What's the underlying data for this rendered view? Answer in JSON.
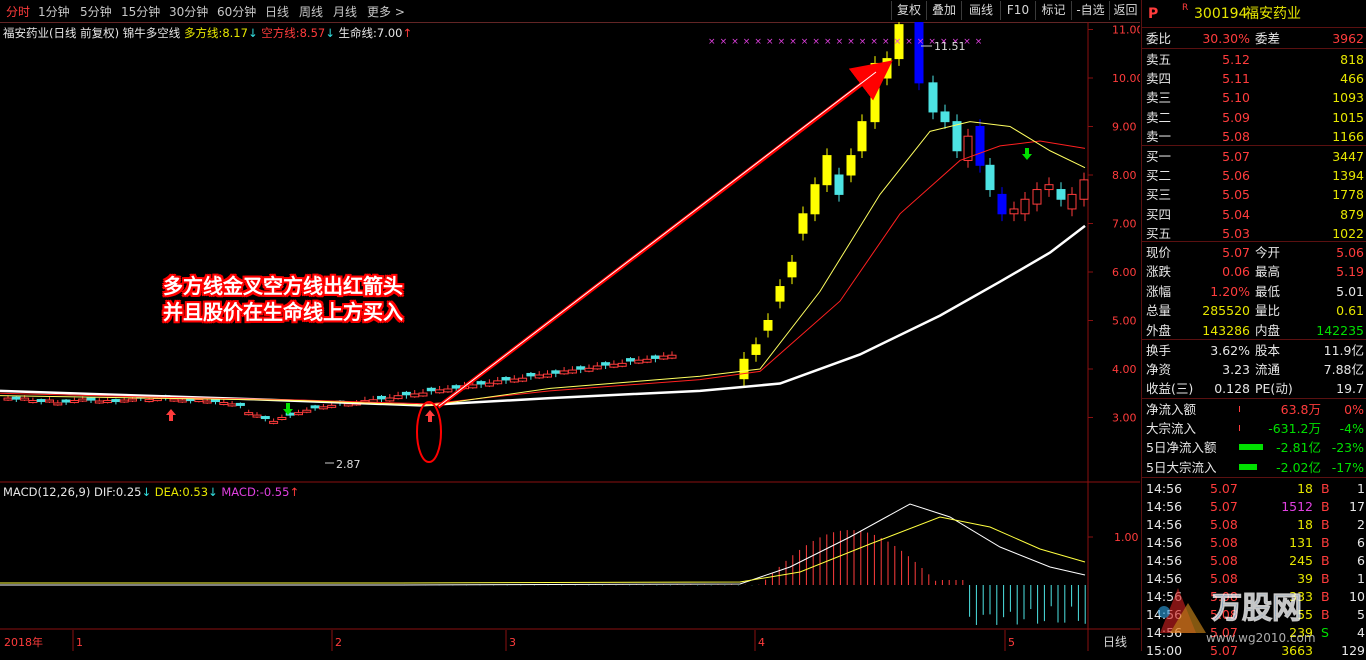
{
  "toolbar": {
    "periods": [
      "分时",
      "1分钟",
      "5分钟",
      "15分钟",
      "30分钟",
      "60分钟",
      "日线",
      "周线",
      "月线",
      "更多 >"
    ],
    "active_period": "分时",
    "buttons": [
      "复权",
      "叠加",
      "画线",
      "F10",
      "标记",
      "-自选",
      "返回"
    ]
  },
  "main_indicator": {
    "stock": "福安药业(日线 前复权)",
    "name": "锦牛多空线",
    "long_label": "多方线:",
    "long_value": "8.17",
    "long_arrow": "↓",
    "short_label": "空方线:",
    "short_value": "8.57",
    "short_arrow": "↓",
    "life_label": "生命线:",
    "life_value": "7.00",
    "life_arrow": "↑"
  },
  "macd_indicator": {
    "name": "MACD(12,26,9)",
    "dif_label": "DIF:",
    "dif_value": "0.25",
    "dif_arrow": "↓",
    "dea_label": "DEA:",
    "dea_value": "0.53",
    "dea_arrow": "↓",
    "macd_label": "MACD:",
    "macd_value": "-0.55",
    "macd_arrow": "↑"
  },
  "annotation": {
    "line1": "多方线金叉空方线出红箭头",
    "line2": "并且股价在生命线上方买入"
  },
  "price_axis": [
    "11.00",
    "10.00",
    "9.00",
    "8.00",
    "7.00",
    "6.00",
    "5.00",
    "4.00",
    "3.00"
  ],
  "macd_axis": "1.00",
  "chart_labels": {
    "high": "11.51",
    "low": "2.87"
  },
  "time_axis": {
    "year": "2018年",
    "months": [
      "1",
      "2",
      "3",
      "4",
      "5"
    ],
    "period_label": "日线"
  },
  "colors": {
    "up": "#ff3c3c",
    "down": "#00e000",
    "yellow_candle": "#ffff00",
    "blue_candle": "#0000ff",
    "cyan_candle": "#4de3e3",
    "accent": "#ff3c3c"
  },
  "quote": {
    "market_icon": "P",
    "r_icon": "R",
    "code": "300194",
    "name": "福安药业",
    "weibi_label": "委比",
    "weibi": "30.30%",
    "weicha_label": "委差",
    "weicha": "3962",
    "asks": [
      {
        "label": "卖五",
        "price": "5.12",
        "vol": "818"
      },
      {
        "label": "卖四",
        "price": "5.11",
        "vol": "466"
      },
      {
        "label": "卖三",
        "price": "5.10",
        "vol": "1093"
      },
      {
        "label": "卖二",
        "price": "5.09",
        "vol": "1015"
      },
      {
        "label": "卖一",
        "price": "5.08",
        "vol": "1166"
      }
    ],
    "bids": [
      {
        "label": "买一",
        "price": "5.07",
        "vol": "3447"
      },
      {
        "label": "买二",
        "price": "5.06",
        "vol": "1394"
      },
      {
        "label": "买三",
        "price": "5.05",
        "vol": "1778"
      },
      {
        "label": "买四",
        "price": "5.04",
        "vol": "879"
      },
      {
        "label": "买五",
        "price": "5.03",
        "vol": "1022"
      }
    ],
    "stats": [
      {
        "l1": "现价",
        "v1": "5.07",
        "l2": "今开",
        "v2": "5.06"
      },
      {
        "l1": "涨跌",
        "v1": "0.06",
        "l2": "最高",
        "v2": "5.19"
      },
      {
        "l1": "涨幅",
        "v1": "1.20%",
        "l2": "最低",
        "v2": "5.01"
      },
      {
        "l1": "总量",
        "v1": "285520",
        "l2": "量比",
        "v2": "0.61"
      },
      {
        "l1": "外盘",
        "v1": "143286",
        "l2": "内盘",
        "v2": "142235"
      }
    ],
    "fund": [
      {
        "l1": "换手",
        "v1": "3.62%",
        "l2": "股本",
        "v2": "11.9亿"
      },
      {
        "l1": "净资",
        "v1": "3.23",
        "l2": "流通",
        "v2": "7.88亿"
      },
      {
        "l1": "收益(三)",
        "v1": "0.128",
        "l2": "PE(动)",
        "v2": "19.7"
      }
    ],
    "flows": [
      {
        "label": "净流入额",
        "value": "63.8万",
        "pct": "0%",
        "bar": 0.0
      },
      {
        "label": "大宗流入",
        "value": "-631.2万",
        "pct": "-4%",
        "bar": 0.0
      },
      {
        "label": "5日净流入额",
        "value": "-2.81亿",
        "pct": "-23%",
        "bar": 0.23
      },
      {
        "label": "5日大宗流入",
        "value": "-2.02亿",
        "pct": "-17%",
        "bar": 0.17
      }
    ],
    "ticks": [
      {
        "time": "14:56",
        "price": "5.07",
        "vol": "18",
        "side": "B",
        "n": "1"
      },
      {
        "time": "14:56",
        "price": "5.07",
        "vol": "1512",
        "side": "B",
        "n": "17"
      },
      {
        "time": "14:56",
        "price": "5.08",
        "vol": "18",
        "side": "B",
        "n": "2"
      },
      {
        "time": "14:56",
        "price": "5.08",
        "vol": "131",
        "side": "B",
        "n": "6"
      },
      {
        "time": "14:56",
        "price": "5.08",
        "vol": "245",
        "side": "B",
        "n": "6"
      },
      {
        "time": "14:56",
        "price": "5.08",
        "vol": "39",
        "side": "B",
        "n": "1"
      },
      {
        "time": "14:56",
        "price": "5.08",
        "vol": "333",
        "side": "B",
        "n": "10"
      },
      {
        "time": "14:56",
        "price": "5.08",
        "vol": "55",
        "side": "B",
        "n": "5"
      },
      {
        "time": "14:56",
        "price": "5.07",
        "vol": "239",
        "side": "S",
        "n": "4"
      },
      {
        "time": "15:00",
        "price": "5.07",
        "vol": "3663",
        "side": "",
        "n": "129"
      }
    ]
  },
  "watermark": {
    "brand": "万股网",
    "url": "www.wg2010.com"
  }
}
